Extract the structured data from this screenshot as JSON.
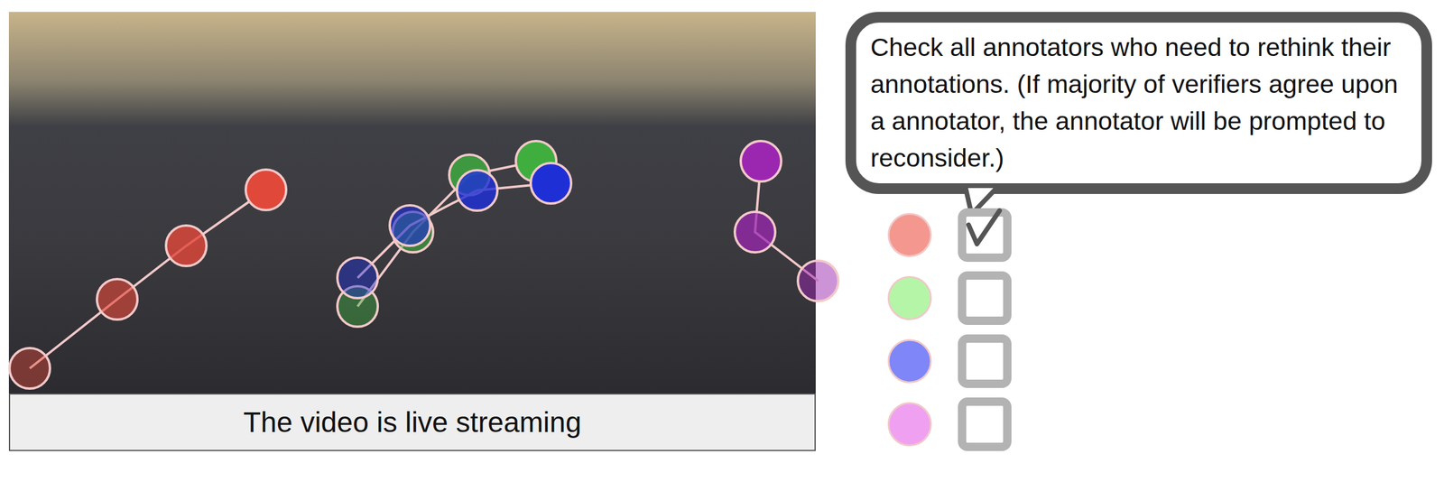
{
  "video": {
    "caption": "The video is live streaming"
  },
  "prompt": "Check all annotators who need to rethink their annotations. (If majority of verifiers agree upon a annotator, the annotator will be prompted to reconsider.)",
  "annotators": [
    {
      "color": "#f4978e",
      "track_color": "#e0483a",
      "checked": true
    },
    {
      "color": "#b5f5a7",
      "track_color": "#3fae3f",
      "checked": false
    },
    {
      "color": "#7f86f7",
      "track_color": "#1f2fd6",
      "checked": false
    },
    {
      "color": "#f0a0f0",
      "track_color": "#9b27b0",
      "checked": false
    }
  ]
}
